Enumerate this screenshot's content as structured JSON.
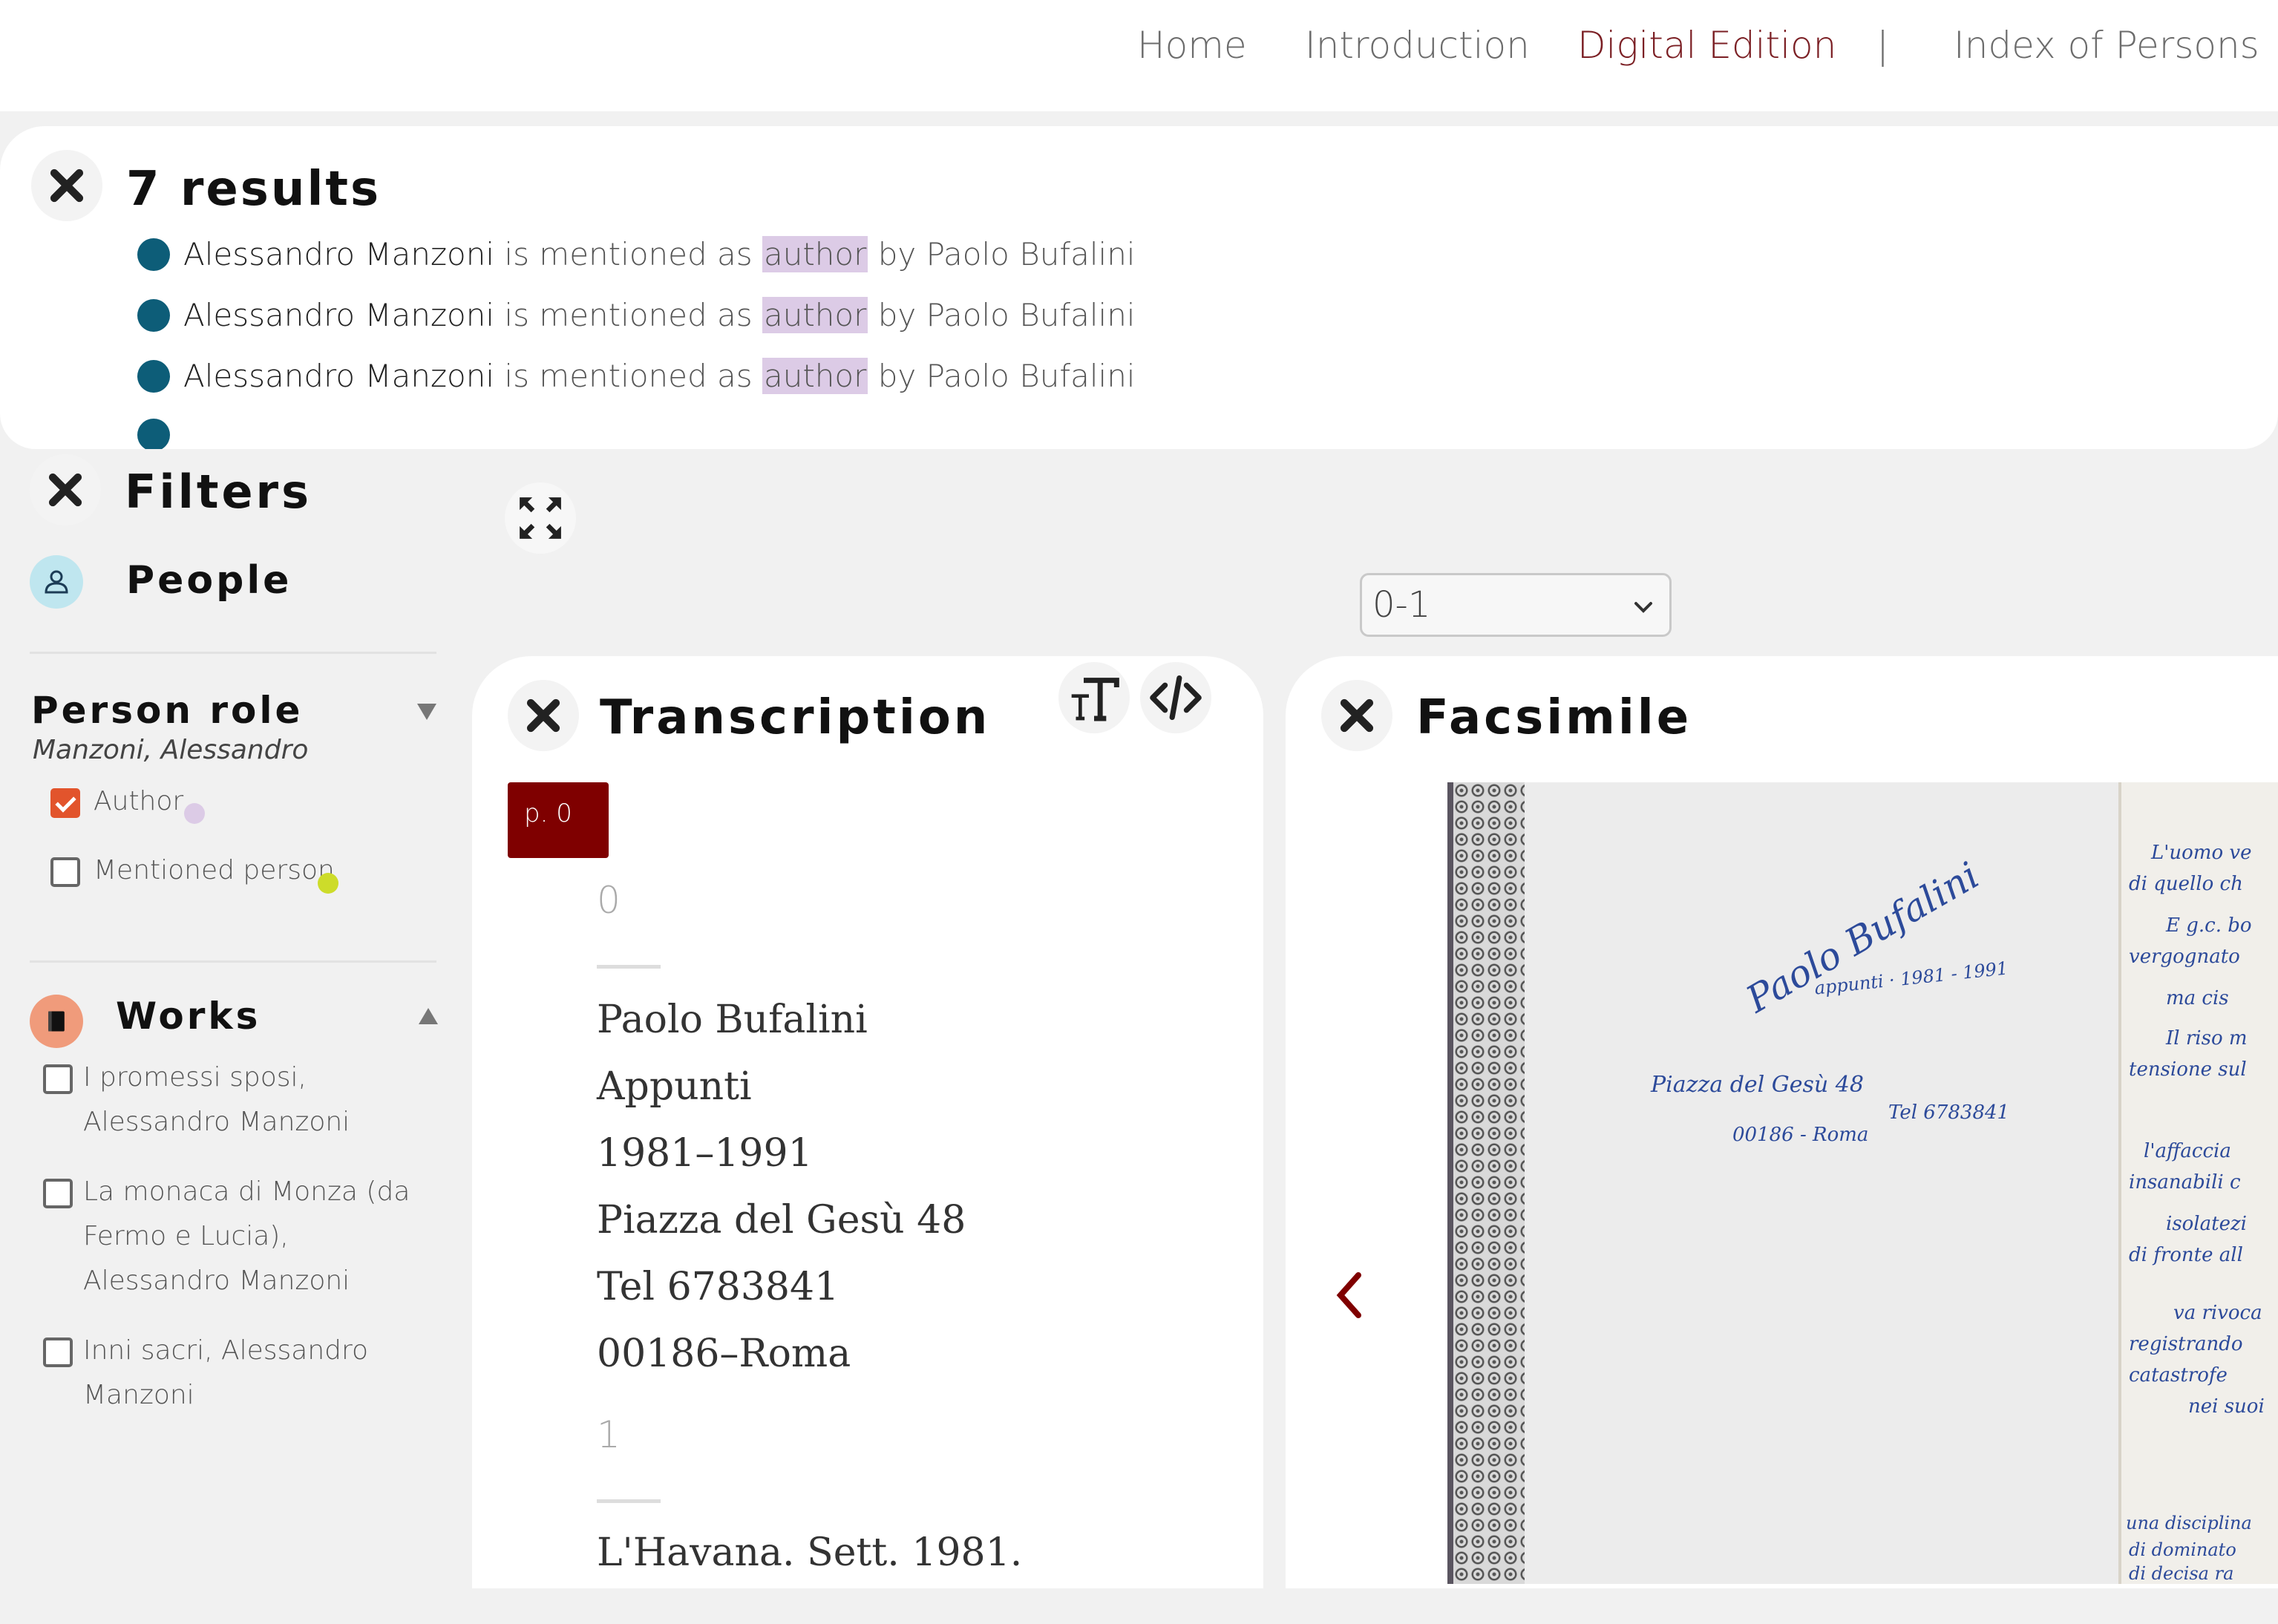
{
  "nav": {
    "items": [
      "Home",
      "Introduction",
      "Digital Edition",
      "|",
      "Index of Persons"
    ],
    "active": "Digital Edition",
    "active_color": "#7b1f24"
  },
  "results": {
    "title": "7 results",
    "close_icon": "close-icon",
    "rows": [
      {
        "person": "Alessandro Manzoni",
        "middle": "is mentioned as",
        "role": "author",
        "tail": "by Paolo Bufalini"
      },
      {
        "person": "Alessandro Manzoni",
        "middle": "is mentioned as",
        "role": "author",
        "tail": "by Paolo Bufalini"
      },
      {
        "person": "Alessandro Manzoni",
        "middle": "is mentioned as",
        "role": "author",
        "tail": "by Paolo Bufalini"
      }
    ],
    "dot_color": "#0d5d78",
    "role_highlight": "#dccbe6"
  },
  "filters": {
    "title": "Filters",
    "people_label": "People",
    "person_role": {
      "title": "Person role",
      "subtitle": "Manzoni, Alessandro",
      "options": [
        {
          "label": "Author",
          "checked": true,
          "color": "#dccbe6"
        },
        {
          "label": "Mentioned person",
          "checked": false,
          "color": "#cddc2a"
        }
      ]
    },
    "works": {
      "title": "Works",
      "items": [
        {
          "label": "I promessi sposi, Alessandro Manzoni",
          "checked": false
        },
        {
          "label": "La monaca di Monza (da Fermo e Lucia), Alessandro Manzoni",
          "checked": false
        },
        {
          "label": "Inni sacri, Alessandro Manzoni",
          "checked": false
        }
      ]
    }
  },
  "page_select": {
    "value": "0-1"
  },
  "transcription": {
    "title": "Transcription",
    "page_tag": "p. 0",
    "blocks": [
      {
        "number": "0",
        "lines": [
          "Paolo Bufalini",
          "Appunti",
          "1981–1991",
          "Piazza del Gesù 48",
          "Tel 6783841",
          "00186–Roma"
        ]
      },
      {
        "number": "1",
        "lines": [
          "L'Havana. Sett. 1981."
        ]
      }
    ]
  },
  "facsimile": {
    "title": "Facsimile",
    "handwriting": {
      "signature": "Paolo Bufalini",
      "note": "appunti · 1981 - 1991",
      "address": "Piazza del Gesù 48",
      "zip": "00186 - Roma",
      "tel": "Tel 6783841",
      "right_page": [
        "L'uomo ve",
        "di quello ch",
        "E g.c. bo",
        "vergognato",
        "ma cis",
        "Il riso m",
        "tensione sul",
        "l'affaccia",
        "insanabili c",
        "isolatezi",
        "di fronte all",
        "va rivoca",
        "registrando",
        "catastrofe",
        "nei suoi",
        "una disciplina",
        "di dominato",
        "di decisa ra"
      ]
    }
  }
}
